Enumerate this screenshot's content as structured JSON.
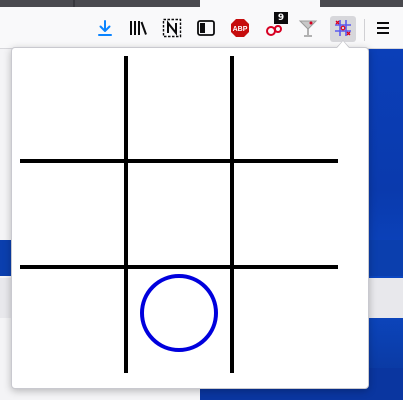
{
  "toolbar": {
    "icons": [
      {
        "name": "download-icon",
        "color": "#0a84ff"
      },
      {
        "name": "library-icon",
        "color": "#0c0c0d"
      },
      {
        "name": "notion-clipper-icon",
        "color": "#0c0c0d"
      },
      {
        "name": "sidebar-icon",
        "color": "#0c0c0d"
      },
      {
        "name": "adblock-plus-icon",
        "label": "ABP",
        "color": "#c60d0d"
      },
      {
        "name": "extension-badge-icon",
        "badge": "9",
        "color": "#d70022"
      },
      {
        "name": "cocktail-icon",
        "color": "#b0b0b0"
      },
      {
        "name": "tic-tac-toe-icon",
        "color": "#d70022"
      },
      {
        "name": "hamburger-menu-icon",
        "color": "#0c0c0d"
      }
    ]
  },
  "board": {
    "line_color": "#000000",
    "mark_color": "#0000dd",
    "cells": [
      "",
      "",
      "",
      "",
      "",
      "",
      "",
      "O",
      ""
    ]
  }
}
